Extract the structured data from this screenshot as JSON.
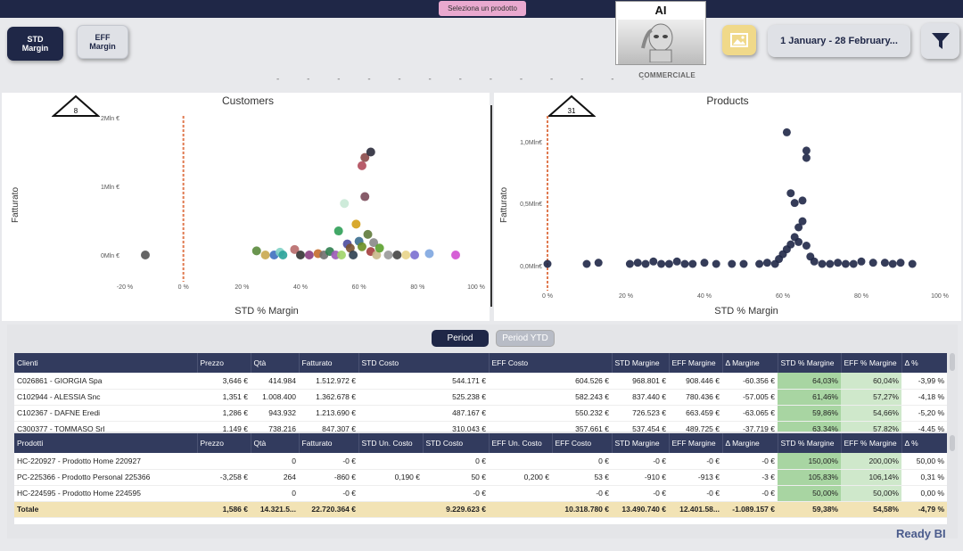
{
  "header": {
    "select_product": "Seleziona un prodotto",
    "std_button": "STD\nMargin",
    "std_line1": "STD",
    "std_line2": "Margin",
    "eff_line1": "EFF",
    "eff_line2": "Margin",
    "ai_label": "AI",
    "date_range": "1 January - 28 February...",
    "commerciale": "COMMERCIALE"
  },
  "customers_chart": {
    "title": "Customers",
    "badge": "8",
    "ylabel": "Fatturato",
    "xlabel": "STD % Margin",
    "yticks": [
      "2Mln €",
      "1Mln €",
      "0Mln €"
    ],
    "xticks": [
      "-20 %",
      "0 %",
      "20 %",
      "40 %",
      "60 %",
      "80 %",
      "100 %"
    ]
  },
  "products_chart": {
    "title": "Products",
    "badge": "31",
    "ylabel": "Fatturato",
    "xlabel": "STD % Margin",
    "yticks": [
      "1,0Mln€",
      "0,5Mln€",
      "0,0Mln€"
    ],
    "xticks": [
      "0 %",
      "20 %",
      "40 %",
      "60 %",
      "80 %",
      "100 %"
    ]
  },
  "chart_data": [
    {
      "type": "scatter",
      "title": "Customers",
      "xlabel": "STD % Margin",
      "ylabel": "Fatturato",
      "xlim": [
        -20,
        100
      ],
      "ylim": [
        0,
        2000000
      ],
      "reference_line_x": 0,
      "points": [
        {
          "x": -13,
          "y": 0,
          "color": "#555555"
        },
        {
          "x": 25,
          "y": 60000,
          "color": "#5a8a3c"
        },
        {
          "x": 28,
          "y": 0,
          "color": "#c9a94f"
        },
        {
          "x": 31,
          "y": 0,
          "color": "#3e6fbf"
        },
        {
          "x": 33,
          "y": 40000,
          "color": "#7fd1c5"
        },
        {
          "x": 34,
          "y": 0,
          "color": "#2ba39a"
        },
        {
          "x": 38,
          "y": 80000,
          "color": "#b86a6a"
        },
        {
          "x": 40,
          "y": 0,
          "color": "#333333"
        },
        {
          "x": 43,
          "y": 0,
          "color": "#8a3d7f"
        },
        {
          "x": 46,
          "y": 20000,
          "color": "#c46b2c"
        },
        {
          "x": 48,
          "y": 0,
          "color": "#6f6f6f"
        },
        {
          "x": 50,
          "y": 50000,
          "color": "#2f7e4f"
        },
        {
          "x": 52,
          "y": 0,
          "color": "#9b59b6"
        },
        {
          "x": 53,
          "y": 350000,
          "color": "#2e9e56"
        },
        {
          "x": 54,
          "y": 0,
          "color": "#a0d468"
        },
        {
          "x": 55,
          "y": 750000,
          "color": "#c9e9d6"
        },
        {
          "x": 56,
          "y": 160000,
          "color": "#4b4b9e"
        },
        {
          "x": 57,
          "y": 100000,
          "color": "#7a5230"
        },
        {
          "x": 58,
          "y": 0,
          "color": "#2c3e50"
        },
        {
          "x": 59,
          "y": 450000,
          "color": "#d4a017"
        },
        {
          "x": 60,
          "y": 200000,
          "color": "#3b6e8f"
        },
        {
          "x": 61,
          "y": 120000,
          "color": "#6b8e23"
        },
        {
          "x": 61,
          "y": 1300000,
          "color": "#b04a5a"
        },
        {
          "x": 62,
          "y": 1420000,
          "color": "#8b4a4a"
        },
        {
          "x": 62,
          "y": 850000,
          "color": "#7a4a5a"
        },
        {
          "x": 63,
          "y": 300000,
          "color": "#5f7a3a"
        },
        {
          "x": 64,
          "y": 1500000,
          "color": "#2b2b3b"
        },
        {
          "x": 64,
          "y": 50000,
          "color": "#a33d3d"
        },
        {
          "x": 65,
          "y": 180000,
          "color": "#888888"
        },
        {
          "x": 66,
          "y": 0,
          "color": "#c9b98a"
        },
        {
          "x": 67,
          "y": 100000,
          "color": "#5aa02c"
        },
        {
          "x": 70,
          "y": 0,
          "color": "#999999"
        },
        {
          "x": 73,
          "y": 0,
          "color": "#444444"
        },
        {
          "x": 76,
          "y": 0,
          "color": "#e8d48a"
        },
        {
          "x": 79,
          "y": 0,
          "color": "#7b6fd0"
        },
        {
          "x": 84,
          "y": 20000,
          "color": "#7ea6e0"
        },
        {
          "x": 93,
          "y": 0,
          "color": "#d24fd2"
        }
      ]
    },
    {
      "type": "scatter",
      "title": "Products",
      "xlabel": "STD % Margin",
      "ylabel": "Fatturato",
      "xlim": [
        0,
        100
      ],
      "ylim": [
        0,
        1200000
      ],
      "reference_line_x": 0,
      "color": "#1f2747",
      "points": [
        {
          "x": 0,
          "y": 0
        },
        {
          "x": 10,
          "y": 0
        },
        {
          "x": 13,
          "y": 10000
        },
        {
          "x": 21,
          "y": 0
        },
        {
          "x": 23,
          "y": 10000
        },
        {
          "x": 25,
          "y": 0
        },
        {
          "x": 27,
          "y": 20000
        },
        {
          "x": 29,
          "y": 0
        },
        {
          "x": 31,
          "y": 0
        },
        {
          "x": 33,
          "y": 20000
        },
        {
          "x": 35,
          "y": 0
        },
        {
          "x": 37,
          "y": 0
        },
        {
          "x": 40,
          "y": 10000
        },
        {
          "x": 43,
          "y": 0
        },
        {
          "x": 47,
          "y": 0
        },
        {
          "x": 50,
          "y": 0
        },
        {
          "x": 54,
          "y": 0
        },
        {
          "x": 56,
          "y": 10000
        },
        {
          "x": 58,
          "y": 0
        },
        {
          "x": 59,
          "y": 40000
        },
        {
          "x": 60,
          "y": 80000
        },
        {
          "x": 61,
          "y": 120000
        },
        {
          "x": 61,
          "y": 1080000
        },
        {
          "x": 62,
          "y": 160000
        },
        {
          "x": 62,
          "y": 580000
        },
        {
          "x": 63,
          "y": 220000
        },
        {
          "x": 63,
          "y": 500000
        },
        {
          "x": 64,
          "y": 300000
        },
        {
          "x": 64,
          "y": 180000
        },
        {
          "x": 65,
          "y": 350000
        },
        {
          "x": 65,
          "y": 520000
        },
        {
          "x": 66,
          "y": 150000
        },
        {
          "x": 66,
          "y": 930000
        },
        {
          "x": 66,
          "y": 870000
        },
        {
          "x": 67,
          "y": 60000
        },
        {
          "x": 68,
          "y": 20000
        },
        {
          "x": 70,
          "y": 0
        },
        {
          "x": 72,
          "y": 0
        },
        {
          "x": 74,
          "y": 10000
        },
        {
          "x": 76,
          "y": 0
        },
        {
          "x": 78,
          "y": 0
        },
        {
          "x": 80,
          "y": 20000
        },
        {
          "x": 83,
          "y": 10000
        },
        {
          "x": 86,
          "y": 10000
        },
        {
          "x": 88,
          "y": 0
        },
        {
          "x": 90,
          "y": 10000
        },
        {
          "x": 93,
          "y": 0
        }
      ]
    }
  ],
  "tabs": {
    "period": "Period",
    "period_ytd": "Period YTD"
  },
  "clients_table": {
    "headers": [
      "Clienti",
      "Prezzo",
      "Qtà",
      "Fatturato",
      "STD Costo",
      "EFF Costo",
      "STD Margine",
      "EFF Margine",
      "Δ Margine",
      "STD % Margine",
      "EFF % Margine",
      "Δ %"
    ],
    "rows": [
      [
        "C026861 - GIORGIA Spa",
        "3,646 €",
        "414.984",
        "1.512.972 €",
        "544.171 €",
        "604.526 €",
        "968.801 €",
        "908.446 €",
        "-60.356 €",
        "64,03%",
        "60,04%",
        "-3,99 %"
      ],
      [
        "C102944 - ALESSIA Snc",
        "1,351 €",
        "1.008.400",
        "1.362.678 €",
        "525.238 €",
        "582.243 €",
        "837.440 €",
        "780.436 €",
        "-57.005 €",
        "61,46%",
        "57,27%",
        "-4,18 %"
      ],
      [
        "C102367 - DAFNE Eredi",
        "1,286 €",
        "943.932",
        "1.213.690 €",
        "487.167 €",
        "550.232 €",
        "726.523 €",
        "663.459 €",
        "-63.065 €",
        "59,86%",
        "54,66%",
        "-5,20 %"
      ],
      [
        "C300377 - TOMMASO Srl",
        "1,149 €",
        "738.216",
        "847.307 €",
        "310.043 €",
        "357.661 €",
        "537.454 €",
        "489.725 €",
        "-37.719 €",
        "63,34%",
        "57,82%",
        "-4,45 %"
      ]
    ]
  },
  "products_table": {
    "headers": [
      "Prodotti",
      "Prezzo",
      "Qtà",
      "Fatturato",
      "STD Un. Costo",
      "STD Costo",
      "EFF Un. Costo",
      "EFF Costo",
      "STD Margine",
      "EFF Margine",
      "Δ Margine",
      "STD % Margine",
      "EFF % Margine",
      "Δ %"
    ],
    "rows": [
      [
        "HC-220927 - Prodotto Home 220927",
        "",
        "0",
        "-0 €",
        "",
        "0 €",
        "",
        "0 €",
        "-0 €",
        "-0 €",
        "-0 €",
        "150,00%",
        "200,00%",
        "50,00 %"
      ],
      [
        "PC-225366 - Prodotto Personal 225366",
        "-3,258 €",
        "264",
        "-860 €",
        "0,190 €",
        "50 €",
        "0,200 €",
        "53 €",
        "-910 €",
        "-913 €",
        "-3 €",
        "105,83%",
        "106,14%",
        "0,31 %"
      ],
      [
        "HC-224595 - Prodotto Home 224595",
        "",
        "0",
        "-0 €",
        "",
        "-0 €",
        "",
        "-0 €",
        "-0 €",
        "-0 €",
        "-0 €",
        "50,00%",
        "50,00%",
        "0,00 %"
      ]
    ],
    "total": [
      "Totale",
      "1,586 €",
      "14.321.5...",
      "22.720.364 €",
      "",
      "9.229.623 €",
      "",
      "10.318.780 €",
      "13.490.740 €",
      "12.401.58...",
      "-1.089.157 €",
      "59,38%",
      "54,58%",
      "-4,79 %"
    ]
  },
  "footer": {
    "logo": "Ready BI"
  }
}
